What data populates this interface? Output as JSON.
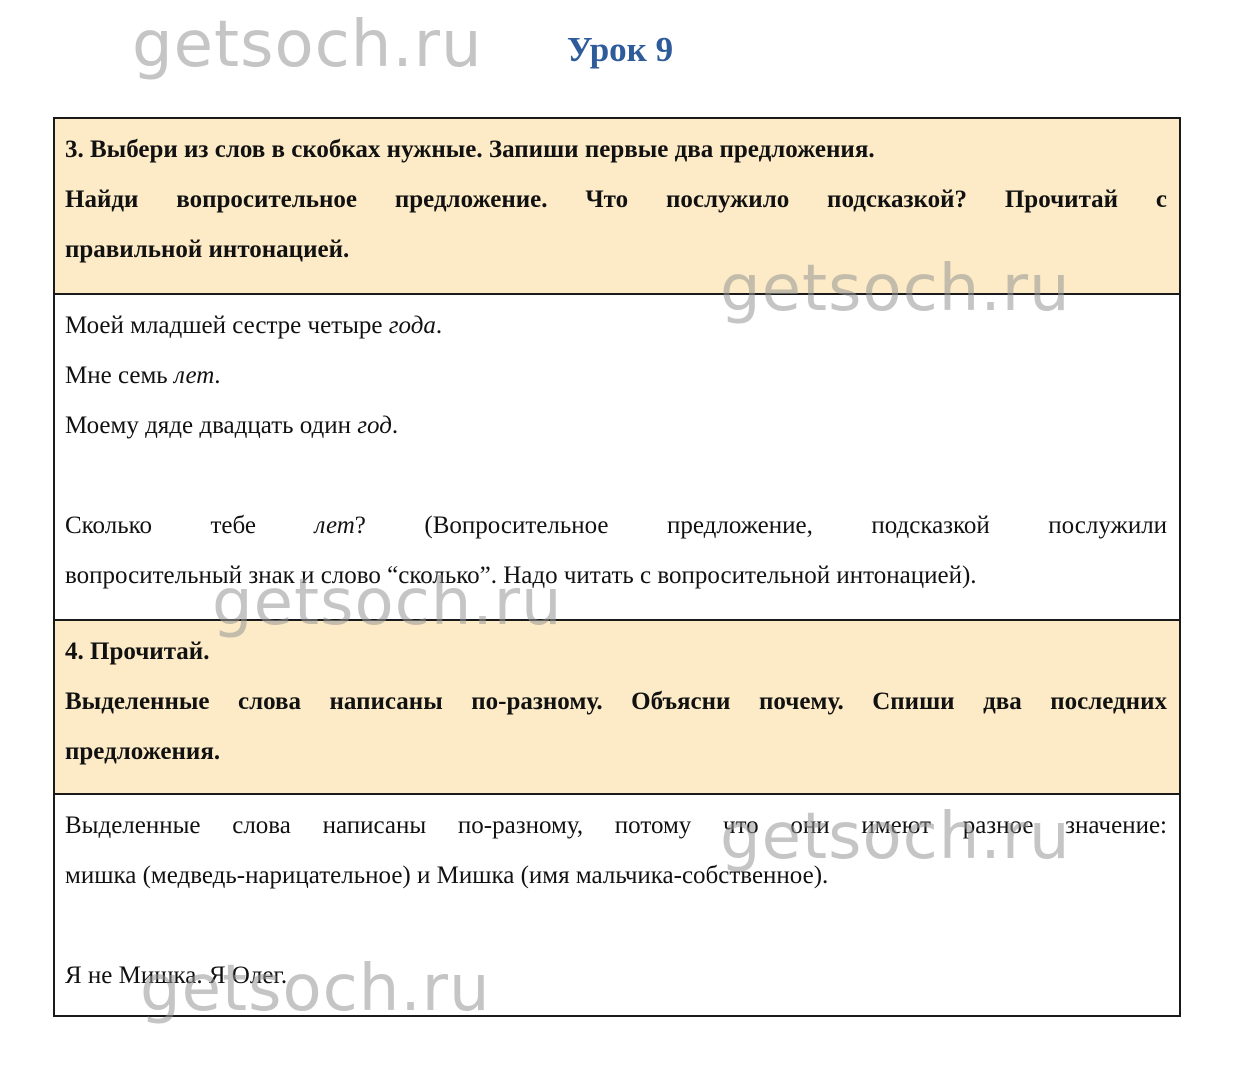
{
  "lesson": {
    "title": "Урок 9"
  },
  "watermarks": [
    "getsoch.ru",
    "getsoch.ru",
    "getsoch.ru",
    "getsoch.ru",
    "getsoch.ru"
  ],
  "task3": {
    "line1": "3. Выбери из слов в скобках нужные. Запиши первые два предложения.",
    "line2": "Найди вопросительное предложение. Что послужило подсказкой? Прочитай с",
    "line3": "правильной интонацией."
  },
  "answer3": {
    "s1_text": "Моей младшей сестре четыре ",
    "s1_word": "года",
    "s1_end": ".",
    "s2_text": "Мне семь ",
    "s2_word": "лет",
    "s2_end": ".",
    "s3_text": "Моему дяде двадцать один ",
    "s3_word": "год",
    "s3_end": ".",
    "q_w1": "Сколько",
    "q_w2": "тебе",
    "q_word": "лет",
    "q_mark": "?",
    "q_w4": "(Вопросительное",
    "q_w5": "предложение,",
    "q_w6": "подсказкой",
    "q_w7": "послужили",
    "q_line2": "вопросительный знак и слово “сколько”. Надо читать с вопросительной интонацией)."
  },
  "task4": {
    "line1": "4. Прочитай.",
    "line2": "Выделенные слова написаны по-разному. Объясни почему. Спиши два последних",
    "line3": "предложения."
  },
  "answer4": {
    "line1": "Выделенные слова написаны по-разному, потому что они имеют разное значение:",
    "line2": "мишка (медведь-нарицательное) и Мишка (имя мальчика-собственное).",
    "line3": "Я не Мишка. Я Олег."
  }
}
